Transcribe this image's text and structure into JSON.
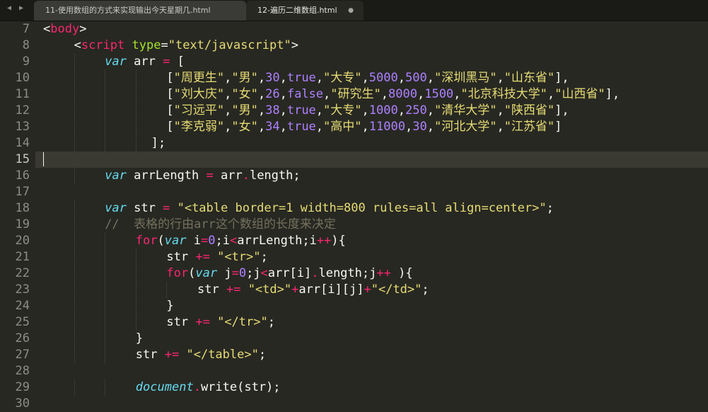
{
  "window": {
    "nav_back_icon": "triangle-left-icon",
    "nav_forward_icon": "triangle-right-icon"
  },
  "tabs": [
    {
      "label": "11-使用数组的方式来实现输出今天星期几.html",
      "active": false
    },
    {
      "label": "12-遍历二维数组.html",
      "active": true,
      "close_icon": "dot-unsaved-icon"
    }
  ],
  "editor": {
    "current_line": 15,
    "lines": [
      {
        "no": "7",
        "indent": 0,
        "tokens": [
          [
            "t-p",
            "<"
          ],
          [
            "t-tag",
            "body"
          ],
          [
            "t-p",
            ">"
          ]
        ]
      },
      {
        "no": "8",
        "indent": 4,
        "tokens": [
          [
            "t-p",
            "<"
          ],
          [
            "t-tag",
            "script"
          ],
          [
            "t-p",
            " "
          ],
          [
            "t-attr",
            "type"
          ],
          [
            "t-p",
            "="
          ],
          [
            "t-str",
            "\"text/javascript\""
          ],
          [
            "t-p",
            ">"
          ]
        ]
      },
      {
        "no": "9",
        "indent": 8,
        "tokens": [
          [
            "t-kw",
            "var"
          ],
          [
            "t-id",
            " arr "
          ],
          [
            "t-op",
            "="
          ],
          [
            "t-id",
            " ["
          ]
        ]
      },
      {
        "no": "10",
        "indent": 16,
        "tokens": [
          [
            "t-id",
            "["
          ],
          [
            "t-str",
            "\"周更生\""
          ],
          [
            "t-id",
            ","
          ],
          [
            "t-str",
            "\"男\""
          ],
          [
            "t-id",
            ","
          ],
          [
            "t-num",
            "30"
          ],
          [
            "t-id",
            ","
          ],
          [
            "t-num",
            "true"
          ],
          [
            "t-id",
            ","
          ],
          [
            "t-str",
            "\"大专\""
          ],
          [
            "t-id",
            ","
          ],
          [
            "t-num",
            "5000"
          ],
          [
            "t-id",
            ","
          ],
          [
            "t-num",
            "500"
          ],
          [
            "t-id",
            ","
          ],
          [
            "t-str",
            "\"深圳黑马\""
          ],
          [
            "t-id",
            ","
          ],
          [
            "t-str",
            "\"山东省\""
          ],
          [
            "t-id",
            "],"
          ]
        ]
      },
      {
        "no": "11",
        "indent": 16,
        "tokens": [
          [
            "t-id",
            "["
          ],
          [
            "t-str",
            "\"刘大庆\""
          ],
          [
            "t-id",
            ","
          ],
          [
            "t-str",
            "\"女\""
          ],
          [
            "t-id",
            ","
          ],
          [
            "t-num",
            "26"
          ],
          [
            "t-id",
            ","
          ],
          [
            "t-num",
            "false"
          ],
          [
            "t-id",
            ","
          ],
          [
            "t-str",
            "\"研究生\""
          ],
          [
            "t-id",
            ","
          ],
          [
            "t-num",
            "8000"
          ],
          [
            "t-id",
            ","
          ],
          [
            "t-num",
            "1500"
          ],
          [
            "t-id",
            ","
          ],
          [
            "t-str",
            "\"北京科技大学\""
          ],
          [
            "t-id",
            ","
          ],
          [
            "t-str",
            "\"山西省\""
          ],
          [
            "t-id",
            "],"
          ]
        ]
      },
      {
        "no": "12",
        "indent": 16,
        "tokens": [
          [
            "t-id",
            "["
          ],
          [
            "t-str",
            "\"习远平\""
          ],
          [
            "t-id",
            ","
          ],
          [
            "t-str",
            "\"男\""
          ],
          [
            "t-id",
            ","
          ],
          [
            "t-num",
            "38"
          ],
          [
            "t-id",
            ","
          ],
          [
            "t-num",
            "true"
          ],
          [
            "t-id",
            ","
          ],
          [
            "t-str",
            "\"大专\""
          ],
          [
            "t-id",
            ","
          ],
          [
            "t-num",
            "1000"
          ],
          [
            "t-id",
            ","
          ],
          [
            "t-num",
            "250"
          ],
          [
            "t-id",
            ","
          ],
          [
            "t-str",
            "\"清华大学\""
          ],
          [
            "t-id",
            ","
          ],
          [
            "t-str",
            "\"陕西省\""
          ],
          [
            "t-id",
            "],"
          ]
        ]
      },
      {
        "no": "13",
        "indent": 16,
        "tokens": [
          [
            "t-id",
            "["
          ],
          [
            "t-str",
            "\"李克弱\""
          ],
          [
            "t-id",
            ","
          ],
          [
            "t-str",
            "\"女\""
          ],
          [
            "t-id",
            ","
          ],
          [
            "t-num",
            "34"
          ],
          [
            "t-id",
            ","
          ],
          [
            "t-num",
            "true"
          ],
          [
            "t-id",
            ","
          ],
          [
            "t-str",
            "\"高中\""
          ],
          [
            "t-id",
            ","
          ],
          [
            "t-num",
            "11000"
          ],
          [
            "t-id",
            ","
          ],
          [
            "t-num",
            "30"
          ],
          [
            "t-id",
            ","
          ],
          [
            "t-str",
            "\"河北大学\""
          ],
          [
            "t-id",
            ","
          ],
          [
            "t-str",
            "\"江苏省\""
          ],
          [
            "t-id",
            "]"
          ]
        ]
      },
      {
        "no": "14",
        "indent": 14,
        "tokens": [
          [
            "t-id",
            "];"
          ]
        ]
      },
      {
        "no": "15",
        "indent": 0,
        "tokens": []
      },
      {
        "no": "16",
        "indent": 8,
        "tokens": [
          [
            "t-kw",
            "var"
          ],
          [
            "t-id",
            " arrLength "
          ],
          [
            "t-op",
            "="
          ],
          [
            "t-id",
            " arr"
          ],
          [
            "t-op",
            "."
          ],
          [
            "t-prop",
            "length;"
          ]
        ]
      },
      {
        "no": "17",
        "indent": 0,
        "tokens": []
      },
      {
        "no": "18",
        "indent": 8,
        "tokens": [
          [
            "t-kw",
            "var"
          ],
          [
            "t-id",
            " str "
          ],
          [
            "t-op",
            "="
          ],
          [
            "t-id",
            " "
          ],
          [
            "t-str",
            "\"<table border=1 width=800 rules=all align=center>\""
          ],
          [
            "t-id",
            ";"
          ]
        ]
      },
      {
        "no": "19",
        "indent": 8,
        "tokens": [
          [
            "t-com",
            "//  表格的行由arr这个数组的长度来决定"
          ]
        ]
      },
      {
        "no": "20",
        "indent": 12,
        "tokens": [
          [
            "t-op",
            "for"
          ],
          [
            "t-id",
            "("
          ],
          [
            "t-kw",
            "var"
          ],
          [
            "t-id",
            " i"
          ],
          [
            "t-op",
            "="
          ],
          [
            "t-num",
            "0"
          ],
          [
            "t-id",
            ";i"
          ],
          [
            "t-op",
            "<"
          ],
          [
            "t-id",
            "arrLength;i"
          ],
          [
            "t-op",
            "++"
          ],
          [
            "t-id",
            "){"
          ]
        ]
      },
      {
        "no": "21",
        "indent": 16,
        "tokens": [
          [
            "t-id",
            "str "
          ],
          [
            "t-op",
            "+="
          ],
          [
            "t-id",
            " "
          ],
          [
            "t-str",
            "\"<tr>\""
          ],
          [
            "t-id",
            ";"
          ]
        ]
      },
      {
        "no": "22",
        "indent": 16,
        "tokens": [
          [
            "t-op",
            "for"
          ],
          [
            "t-id",
            "("
          ],
          [
            "t-kw",
            "var"
          ],
          [
            "t-id",
            " j"
          ],
          [
            "t-op",
            "="
          ],
          [
            "t-num",
            "0"
          ],
          [
            "t-id",
            ";j"
          ],
          [
            "t-op",
            "<"
          ],
          [
            "t-id",
            "arr[i]"
          ],
          [
            "t-op",
            "."
          ],
          [
            "t-prop",
            "length;j"
          ],
          [
            "t-op",
            "++"
          ],
          [
            "t-id",
            " ){"
          ]
        ]
      },
      {
        "no": "23",
        "indent": 20,
        "tokens": [
          [
            "t-id",
            "str "
          ],
          [
            "t-op",
            "+="
          ],
          [
            "t-id",
            " "
          ],
          [
            "t-str",
            "\"<td>\""
          ],
          [
            "t-op",
            "+"
          ],
          [
            "t-id",
            "arr[i][j]"
          ],
          [
            "t-op",
            "+"
          ],
          [
            "t-str",
            "\"</td>\""
          ],
          [
            "t-id",
            ";"
          ]
        ]
      },
      {
        "no": "24",
        "indent": 16,
        "tokens": [
          [
            "t-id",
            "}"
          ]
        ]
      },
      {
        "no": "25",
        "indent": 16,
        "tokens": [
          [
            "t-id",
            "str "
          ],
          [
            "t-op",
            "+="
          ],
          [
            "t-id",
            " "
          ],
          [
            "t-str",
            "\"</tr>\""
          ],
          [
            "t-id",
            ";"
          ]
        ]
      },
      {
        "no": "26",
        "indent": 12,
        "tokens": [
          [
            "t-id",
            "}"
          ]
        ]
      },
      {
        "no": "27",
        "indent": 12,
        "tokens": [
          [
            "t-id",
            "str "
          ],
          [
            "t-op",
            "+="
          ],
          [
            "t-id",
            " "
          ],
          [
            "t-str",
            "\"</table>\""
          ],
          [
            "t-id",
            ";"
          ]
        ]
      },
      {
        "no": "28",
        "indent": 0,
        "tokens": []
      },
      {
        "no": "29",
        "indent": 12,
        "tokens": [
          [
            "t-kw",
            "document"
          ],
          [
            "t-op",
            "."
          ],
          [
            "t-prop",
            "write(str);"
          ]
        ]
      },
      {
        "no": "30",
        "indent": 0,
        "tokens": []
      }
    ]
  }
}
